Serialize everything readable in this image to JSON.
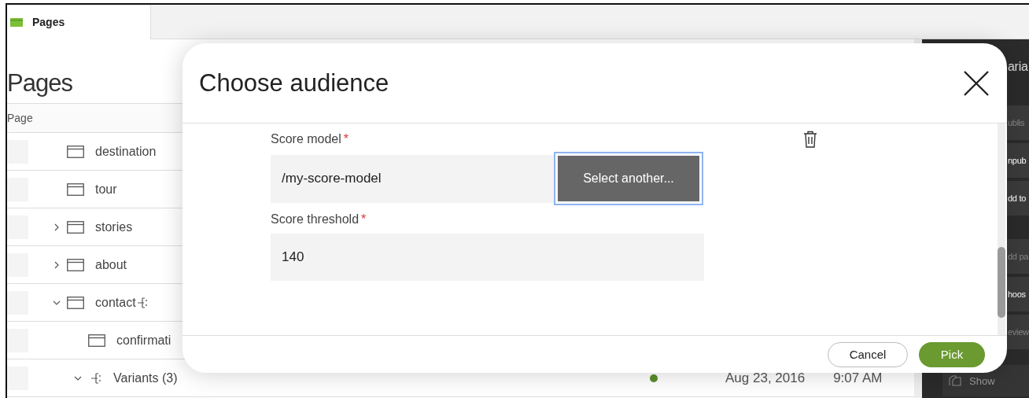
{
  "app_tab": {
    "label": "Pages",
    "selected": true
  },
  "page_title": "Pages",
  "table": {
    "columns": [
      "Page"
    ],
    "rows": [
      {
        "label": "destination",
        "kind": "page"
      },
      {
        "label": "tour",
        "kind": "page"
      },
      {
        "label": "stories",
        "kind": "page",
        "expanded": false
      },
      {
        "label": "about",
        "kind": "page",
        "expanded": false
      },
      {
        "label": "contact",
        "kind": "page",
        "expanded": true,
        "has_variants": true,
        "children": [
          {
            "label": "confirmati",
            "kind": "page"
          },
          {
            "label": "Variants (3)",
            "kind": "variants",
            "expanded": true,
            "color": "#5b8c2a",
            "date": "Aug 23, 2016",
            "time": "9:07 AM"
          }
        ]
      }
    ]
  },
  "side_panel": {
    "title": "aria",
    "actions": [
      {
        "label": "ublis",
        "disabled": true
      },
      {
        "label": "npub",
        "disabled": false
      },
      {
        "label": "dd to",
        "disabled": false
      },
      {
        "label": "dd pa",
        "disabled": true
      },
      {
        "label": "hoos",
        "disabled": false
      },
      {
        "label": "eview",
        "disabled": true
      }
    ],
    "show_button": "Show"
  },
  "dialog": {
    "title": "Choose audience",
    "fields": [
      {
        "kind": "picker",
        "label": "Score model",
        "required_mark": "*",
        "value": "/my-score-model",
        "button": {
          "label": "Select another...",
          "focused": true
        }
      },
      {
        "kind": "text",
        "label": "Score threshold",
        "required_mark": "*",
        "value": "140"
      }
    ],
    "buttons": [
      {
        "label": "Cancel",
        "kind": "secondary"
      },
      {
        "label": "Pick",
        "kind": "primary"
      }
    ]
  }
}
